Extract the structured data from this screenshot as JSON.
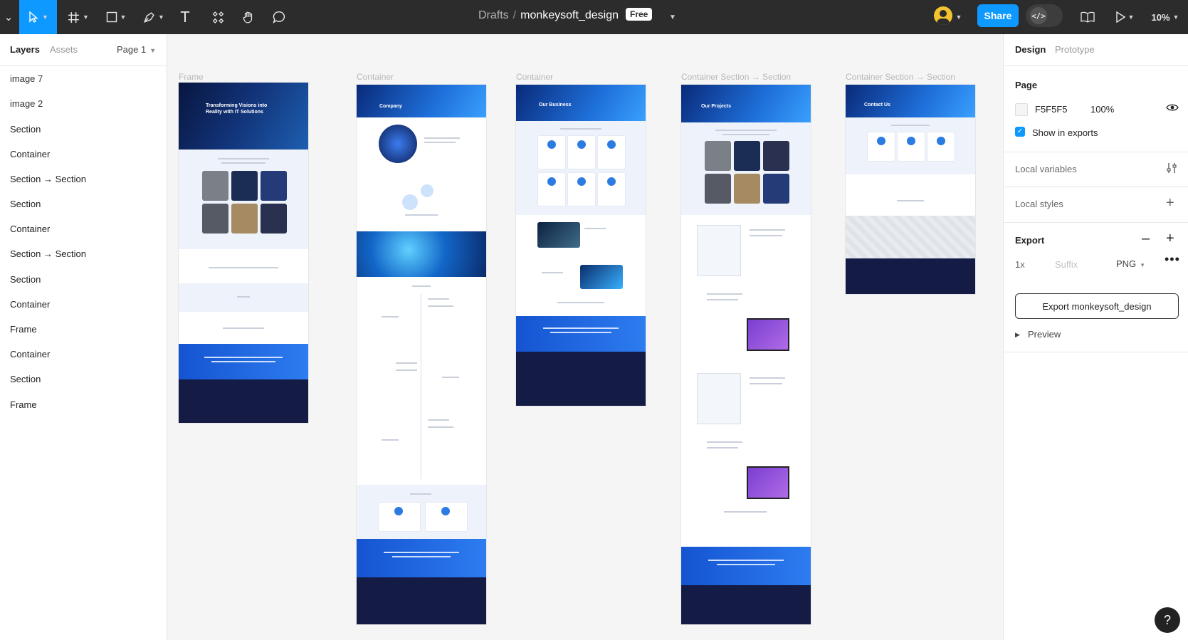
{
  "toolbar": {
    "menu_caret": "⌄",
    "move_icon": "cursor-arrow-icon",
    "frame_icon": "hash-frame-icon",
    "shape_icon": "rectangle-icon",
    "pen_icon": "pen-icon",
    "text_icon": "T",
    "components_icon": "components-icon",
    "hand_icon": "hand-icon",
    "comment_icon": "comment-bubble-icon",
    "breadcrumb_folder": "Drafts",
    "breadcrumb_sep": "/",
    "file_name": "monkeysoft_design",
    "plan_badge": "Free",
    "share_label": "Share",
    "devmode_glyph": "</>",
    "library_icon": "book-icon",
    "play_icon": "play-icon",
    "zoom": "10%"
  },
  "left_panel": {
    "tabs": [
      "Layers",
      "Assets"
    ],
    "page_select": "Page 1",
    "layers": [
      "image 7",
      "image 2",
      "Section",
      "Container",
      "Section → Section",
      "Section",
      "Container",
      "Section → Section",
      "Section",
      "Container",
      "Frame",
      "Container",
      "Section",
      "Frame"
    ]
  },
  "canvas": {
    "frame_labels": [
      "Frame",
      "Container",
      "Container",
      "Container  Section → Section",
      "Container  Section → Section"
    ],
    "f1_hero_text": "Transforming Visions into Reality with IT Solutions",
    "f2_hero_text": "Company",
    "f3_hero_text": "Our Business",
    "f4_hero_text": "Our Projects",
    "f5_hero_text": "Contact Us"
  },
  "right_panel": {
    "tabs": [
      "Design",
      "Prototype"
    ],
    "page_heading": "Page",
    "page_color": "F5F5F5",
    "page_opacity": "100%",
    "show_in_exports": "Show in exports",
    "local_variables": "Local variables",
    "local_styles": "Local styles",
    "export_heading": "Export",
    "export_scale": "1x",
    "export_suffix_placeholder": "Suffix",
    "export_format": "PNG",
    "export_button": "Export monkeysoft_design",
    "preview": "Preview"
  },
  "help": "?",
  "colors": {
    "accent": "#0d99ff",
    "toolbar_bg": "#2c2c2c",
    "canvas_bg": "#F5F5F5"
  }
}
